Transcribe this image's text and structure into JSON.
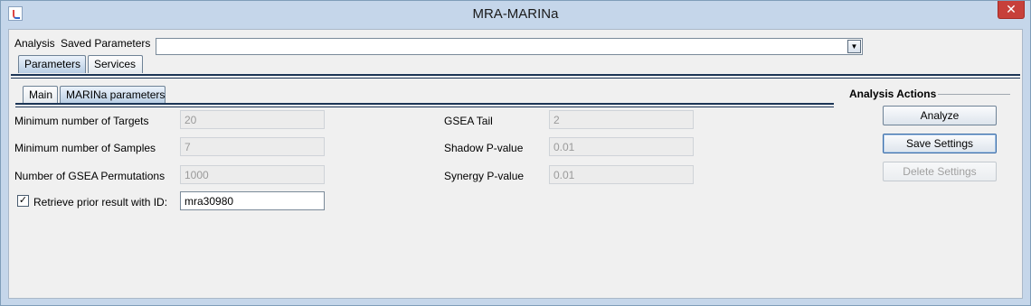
{
  "window": {
    "title": "MRA-MARINa",
    "close_glyph": "✕"
  },
  "top": {
    "analysis_label": "Analysis",
    "saved_params_label": "Saved Parameters",
    "saved_params_value": "",
    "combo_arrow": "▼"
  },
  "outer_tabs": [
    "Parameters",
    "Services"
  ],
  "inner_tabs": [
    "Main",
    "MARINa parameters"
  ],
  "params_left": [
    {
      "label": "Minimum number of Targets",
      "value": "20"
    },
    {
      "label": "Minimum number of Samples",
      "value": "7"
    },
    {
      "label": "Number of GSEA Permutations",
      "value": "1000"
    }
  ],
  "params_right": [
    {
      "label": "GSEA Tail",
      "value": "2"
    },
    {
      "label": "Shadow P-value",
      "value": "0.01"
    },
    {
      "label": "Synergy P-value",
      "value": "0.01"
    }
  ],
  "retrieve": {
    "label": "Retrieve prior result with ID:",
    "checked_glyph": "✓",
    "value": "mra30980"
  },
  "actions": {
    "title": "Analysis Actions",
    "analyze": "Analyze",
    "save": "Save Settings",
    "delete": "Delete Settings"
  },
  "icons": {
    "app": "java-cup-icon",
    "close": "close-icon",
    "dropdown": "chevron-down-icon",
    "checkbox": "checkmark-icon"
  },
  "colors": {
    "title_bar": "#c5d6ea",
    "close_button": "#c7403a",
    "panel": "#f0f0f0",
    "tab_rule": "#1c3556"
  }
}
